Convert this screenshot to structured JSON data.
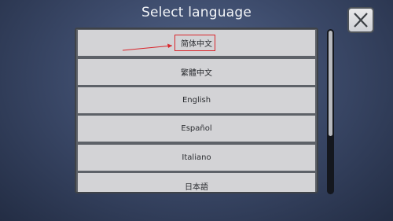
{
  "header": {
    "title": "Select language"
  },
  "close_icon": "close-icon",
  "languages": [
    "简体中文",
    "繁體中文",
    "English",
    "Español",
    "Italiano",
    "日本語"
  ],
  "colors": {
    "item_background": "#d3d3d6",
    "panel_background": "#5d6168",
    "highlight": "#d9262c"
  }
}
